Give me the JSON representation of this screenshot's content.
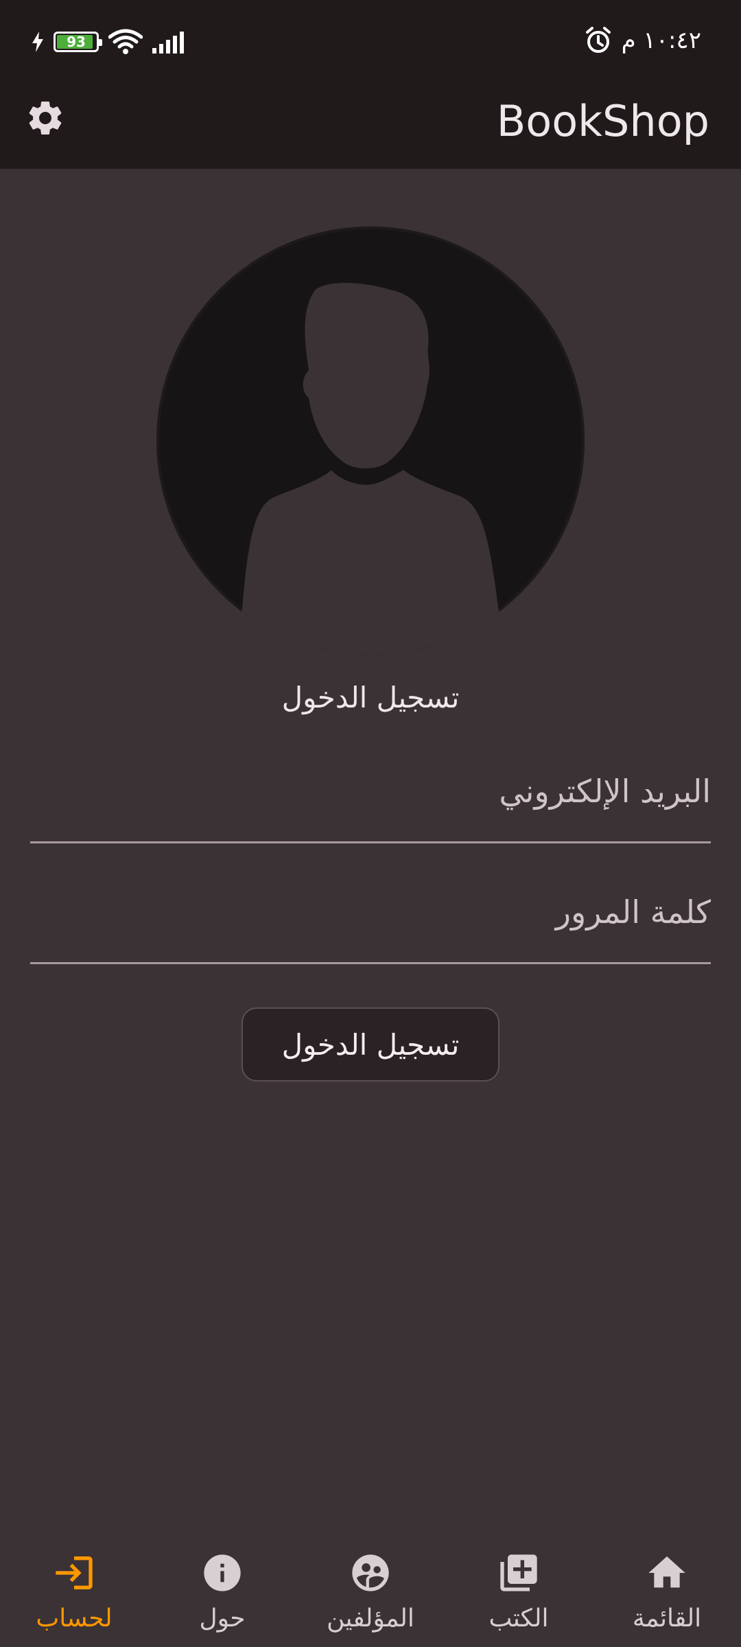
{
  "status_bar": {
    "battery_level": "93",
    "time": "١٠:٤٢ م",
    "icons": [
      "charging-bolt-icon",
      "battery-icon",
      "wifi-icon",
      "cellular-signal-icon",
      "alarm-icon"
    ]
  },
  "app_bar": {
    "title": "BookShop",
    "settings_icon": "gear-icon"
  },
  "login": {
    "avatar_icon": "default-avatar-icon",
    "caption": "تسجيل الدخول",
    "email_label": "البريد الإلكتروني",
    "password_label": "كلمة المرور",
    "button_label": "تسجيل الدخول"
  },
  "bottom_nav": {
    "active_color": "#ff9800",
    "items": [
      {
        "label": "لحساب",
        "icon": "login-icon",
        "active": true
      },
      {
        "label": "حول",
        "icon": "info-icon",
        "active": false
      },
      {
        "label": "المؤلفين",
        "icon": "authors-icon",
        "active": false
      },
      {
        "label": "الكتب",
        "icon": "library-add-icon",
        "active": false
      },
      {
        "label": "القائمة",
        "icon": "home-icon",
        "active": false
      }
    ]
  }
}
